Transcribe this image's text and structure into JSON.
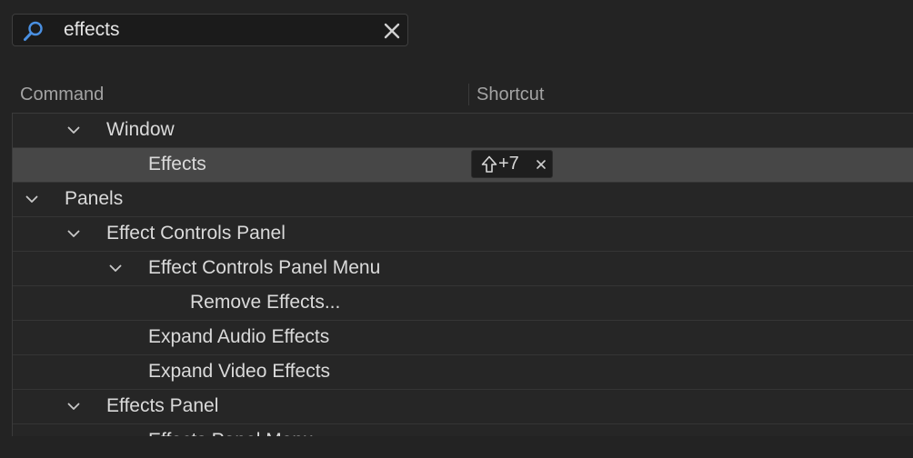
{
  "search": {
    "value": "effects"
  },
  "columns": {
    "command": "Command",
    "shortcut": "Shortcut"
  },
  "rows": [
    {
      "label": "Window",
      "level": 1,
      "expandable": true,
      "selected": false
    },
    {
      "label": "Effects",
      "level": 2,
      "expandable": false,
      "selected": true,
      "shortcut": "+7"
    },
    {
      "label": "Panels",
      "level": 0,
      "expandable": true,
      "selected": false
    },
    {
      "label": "Effect Controls Panel",
      "level": 1,
      "expandable": true,
      "selected": false
    },
    {
      "label": "Effect Controls Panel Menu",
      "level": 2,
      "expandable": true,
      "selected": false
    },
    {
      "label": "Remove Effects...",
      "level": 3,
      "expandable": false,
      "selected": false
    },
    {
      "label": "Expand Audio Effects",
      "level": 2,
      "expandable": false,
      "selected": false
    },
    {
      "label": "Expand Video Effects",
      "level": 2,
      "expandable": false,
      "selected": false
    },
    {
      "label": "Effects Panel",
      "level": 1,
      "expandable": true,
      "selected": false
    },
    {
      "label": "Effects Panel Menu",
      "level": 2,
      "expandable": true,
      "selected": false
    }
  ],
  "colors": {
    "accent_icon": "#4a90e2",
    "background": "#232323",
    "row_selected": "#474747"
  }
}
